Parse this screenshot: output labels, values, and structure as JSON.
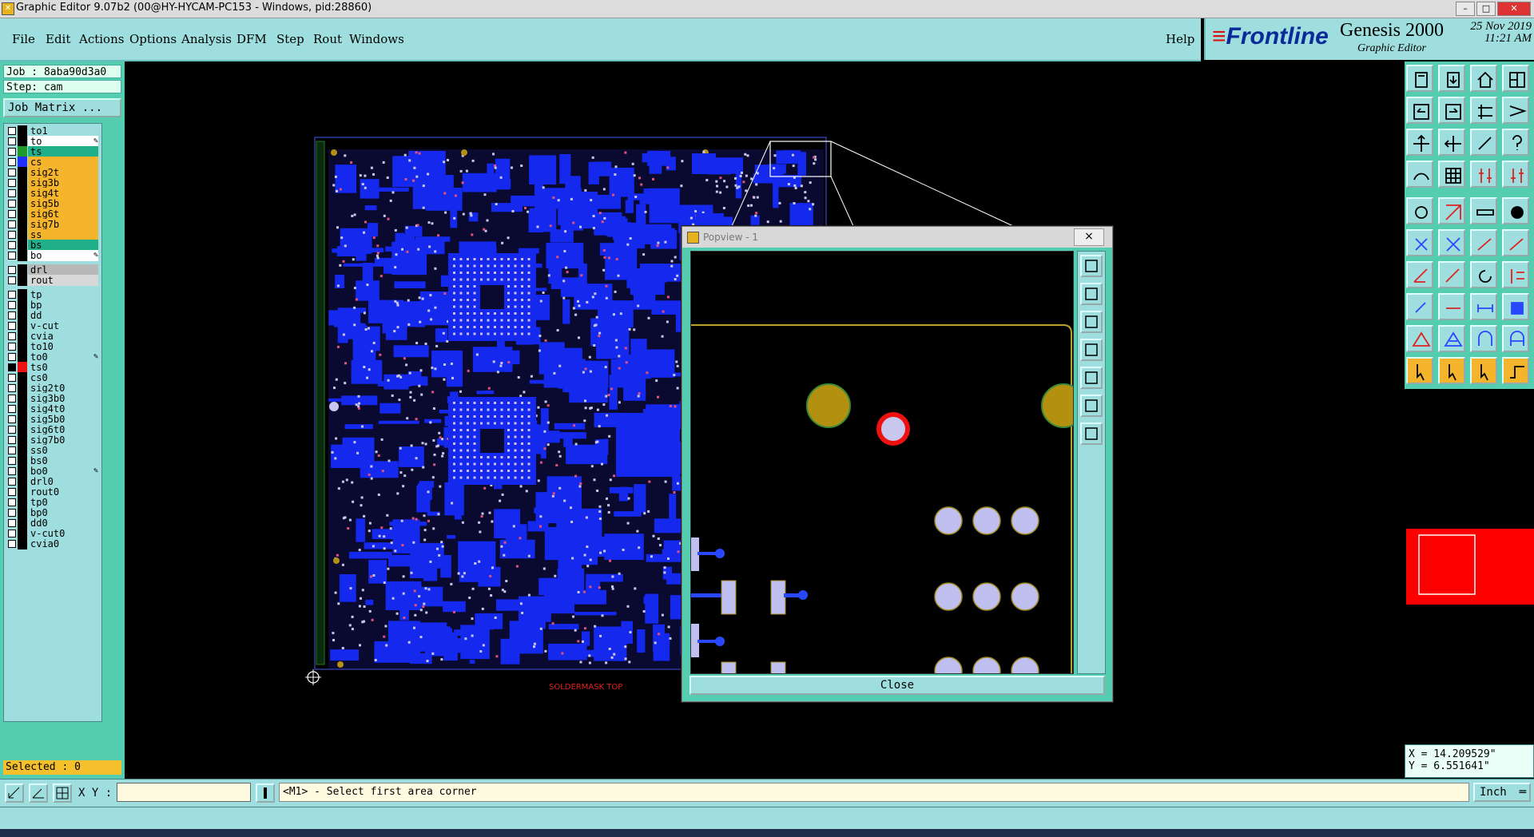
{
  "window": {
    "title": "Graphic Editor 9.07b2 (00@HY-HYCAM-PC153 - Windows, pid:28860)"
  },
  "menu": {
    "items": [
      "File",
      "Edit",
      "Actions",
      "Options",
      "Analysis",
      "DFM",
      "Step",
      "Rout",
      "Windows"
    ],
    "help": "Help"
  },
  "brand": {
    "logo": "Frontline",
    "product": "Genesis 2000",
    "subtitle": "Graphic Editor",
    "date": "25 Nov 2019",
    "time": "11:21 AM"
  },
  "job": {
    "job_label": "Job : 8aba90d3a0",
    "step_label": "Step: cam",
    "matrix_button": "Job Matrix ..."
  },
  "layers": [
    {
      "name": "to1",
      "color": "#000000",
      "bg": "#9fdede"
    },
    {
      "name": "to",
      "color": "#000000",
      "bg": "#ffffff",
      "edit": true
    },
    {
      "name": "ts",
      "color": "#1f9a2a",
      "bg": "#1fb08a"
    },
    {
      "name": "cs",
      "color": "#2030ff",
      "bg": "#f4b42c"
    },
    {
      "name": "sig2t",
      "color": "#000000",
      "bg": "#f4b42c"
    },
    {
      "name": "sig3b",
      "color": "#000000",
      "bg": "#f4b42c"
    },
    {
      "name": "sig4t",
      "color": "#000000",
      "bg": "#f4b42c"
    },
    {
      "name": "sig5b",
      "color": "#000000",
      "bg": "#f4b42c"
    },
    {
      "name": "sig6t",
      "color": "#000000",
      "bg": "#f4b42c"
    },
    {
      "name": "sig7b",
      "color": "#000000",
      "bg": "#f4b42c"
    },
    {
      "name": "ss",
      "color": "#000000",
      "bg": "#f4b42c"
    },
    {
      "name": "bs",
      "color": "#000000",
      "bg": "#1fb08a"
    },
    {
      "name": "bo",
      "color": "#000000",
      "bg": "#ffffff",
      "edit": true
    },
    {
      "name": "drl",
      "color": "#000000",
      "bg": "#b8b8b8",
      "gap": true
    },
    {
      "name": "rout",
      "color": "#000000",
      "bg": "#d8d8d8"
    },
    {
      "name": "tp",
      "color": "#000000",
      "bg": "#9fdede",
      "gap": true
    },
    {
      "name": "bp",
      "color": "#000000",
      "bg": "#9fdede"
    },
    {
      "name": "dd",
      "color": "#000000",
      "bg": "#9fdede"
    },
    {
      "name": "v-cut",
      "color": "#000000",
      "bg": "#9fdede"
    },
    {
      "name": "cvia",
      "color": "#000000",
      "bg": "#9fdede"
    },
    {
      "name": "to10",
      "color": "#000000",
      "bg": "#9fdede"
    },
    {
      "name": "to0",
      "color": "#000000",
      "bg": "#9fdede",
      "edit": true
    },
    {
      "name": "ts0",
      "color": "#ee1111",
      "bg": "#9fdede",
      "active": true
    },
    {
      "name": "cs0",
      "color": "#000000",
      "bg": "#9fdede"
    },
    {
      "name": "sig2t0",
      "color": "#000000",
      "bg": "#9fdede"
    },
    {
      "name": "sig3b0",
      "color": "#000000",
      "bg": "#9fdede"
    },
    {
      "name": "sig4t0",
      "color": "#000000",
      "bg": "#9fdede"
    },
    {
      "name": "sig5b0",
      "color": "#000000",
      "bg": "#9fdede"
    },
    {
      "name": "sig6t0",
      "color": "#000000",
      "bg": "#9fdede"
    },
    {
      "name": "sig7b0",
      "color": "#000000",
      "bg": "#9fdede"
    },
    {
      "name": "ss0",
      "color": "#000000",
      "bg": "#9fdede"
    },
    {
      "name": "bs0",
      "color": "#000000",
      "bg": "#9fdede"
    },
    {
      "name": "bo0",
      "color": "#000000",
      "bg": "#9fdede",
      "edit": true
    },
    {
      "name": "drl0",
      "color": "#000000",
      "bg": "#9fdede"
    },
    {
      "name": "rout0",
      "color": "#000000",
      "bg": "#9fdede"
    },
    {
      "name": "tp0",
      "color": "#000000",
      "bg": "#9fdede"
    },
    {
      "name": "bp0",
      "color": "#000000",
      "bg": "#9fdede"
    },
    {
      "name": "dd0",
      "color": "#000000",
      "bg": "#9fdede"
    },
    {
      "name": "v-cut0",
      "color": "#000000",
      "bg": "#9fdede"
    },
    {
      "name": "cvia0",
      "color": "#000000",
      "bg": "#9fdede"
    }
  ],
  "status": {
    "selected": "Selected : 0"
  },
  "canvas": {
    "layer_label": "SOLDERMASK TOP"
  },
  "popview": {
    "title": "Popview - 1",
    "close_x": "×",
    "close_button": "Close"
  },
  "coords": {
    "x": "X = 14.209529\"",
    "y": "Y = 6.551641\""
  },
  "bottom": {
    "xy_label": "X Y :",
    "message": "<M1> - Select first area corner",
    "units": "Inch"
  },
  "tool_icons": [
    "save-icon",
    "load-icon",
    "home-icon",
    "window-icon",
    "prev-icon",
    "next-icon",
    "edit-icon",
    "zigzag-icon",
    "fit-icon",
    "zoom-icon",
    "scale-icon",
    "help-icon",
    "snap-icon",
    "grid-icon",
    "layers-icon",
    "layers2-icon",
    "pad-icon",
    "diag-icon",
    "ruler-icon",
    "dot-icon",
    "move-icon",
    "cross-icon",
    "line-icon",
    "line2-icon",
    "angle-icon",
    "slash-icon",
    "rotate-icon",
    "align-icon",
    "node-icon",
    "minus-icon",
    "measure-icon",
    "copy-icon",
    "triangle-icon",
    "arrow-up-icon",
    "arc-icon",
    "arc2-icon",
    "pointer-icon",
    "pointer2-icon",
    "pointer3-icon",
    "route-icon"
  ]
}
